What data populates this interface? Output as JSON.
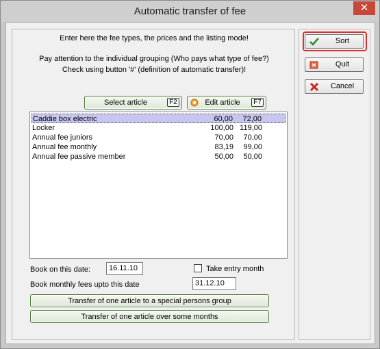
{
  "window": {
    "title": "Automatic transfer of fee",
    "close_glyph": "✕"
  },
  "instructions": {
    "line1": "Enter here the fee types, the prices and the listing mode!",
    "line2": "Pay attention to the individual grouping (Who pays what type of fee?)",
    "line3": "Check using button '#' (definition of automatic transfer)!"
  },
  "select_article": {
    "label": "Select article",
    "key": "F2"
  },
  "edit_article": {
    "label": "Edit article",
    "key": "F7"
  },
  "articles": [
    {
      "name": "Caddie box electric",
      "price1": "60,00",
      "price2": "72,00",
      "selected": true
    },
    {
      "name": "Locker",
      "price1": "100,00",
      "price2": "119,00"
    },
    {
      "name": "Annual fee juniors",
      "price1": "70,00",
      "price2": "70,00"
    },
    {
      "name": "Annual fee monthly",
      "price1": "83,19",
      "price2": "99,00"
    },
    {
      "name": "Annual fee passive member",
      "price1": "50,00",
      "price2": "50,00"
    }
  ],
  "book_date": {
    "label": "Book on this date:",
    "value": "16.11.10"
  },
  "take_entry_month": {
    "label": "Take entry month",
    "checked": false
  },
  "monthly_upto": {
    "label": "Book monthly fees upto this date",
    "value": "31.12.10"
  },
  "actions": {
    "special_group": "Transfer of one article to a special persons group",
    "over_months": "Transfer of one article over some months"
  },
  "right_buttons": {
    "sort": "Sort",
    "quit": "Quit",
    "cancel": "Cancel"
  },
  "colors": {
    "selection": "#c6c6ee",
    "sort_highlight": "#d9322e",
    "close_button": "#c7473a"
  }
}
